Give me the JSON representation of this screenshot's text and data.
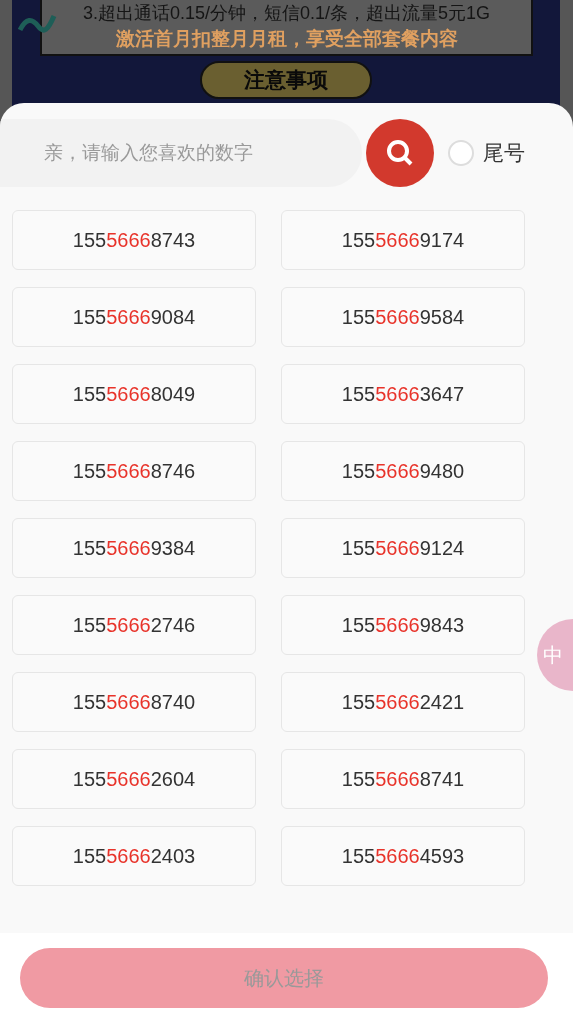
{
  "background": {
    "notes": [
      "3.超出通话0.15/分钟，短信0.1/条，超出流量5元1G",
      "激活首月扣整月月租，享受全部套餐内容"
    ],
    "section_title": "注意事项"
  },
  "search": {
    "placeholder": "亲，请输入您喜欢的数字"
  },
  "tail_option": {
    "label": "尾号",
    "checked": false
  },
  "numbers": [
    {
      "prefix": "155",
      "middle": "5666",
      "suffix": "8743",
      "selected": false
    },
    {
      "prefix": "155",
      "middle": "5666",
      "suffix": "9174",
      "selected": false
    },
    {
      "prefix": "155",
      "middle": "5666",
      "suffix": "9084",
      "selected": false
    },
    {
      "prefix": "155",
      "middle": "5666",
      "suffix": "9584",
      "selected": false
    },
    {
      "prefix": "155",
      "middle": "5666",
      "suffix": "8049",
      "selected": false
    },
    {
      "prefix": "155",
      "middle": "5666",
      "suffix": "3647",
      "selected": false
    },
    {
      "prefix": "155",
      "middle": "5666",
      "suffix": "8746",
      "selected": false
    },
    {
      "prefix": "155",
      "middle": "5666",
      "suffix": "9480",
      "selected": false
    },
    {
      "prefix": "155",
      "middle": "5666",
      "suffix": "9384",
      "selected": false
    },
    {
      "prefix": "155",
      "middle": "5666",
      "suffix": "9124",
      "selected": false
    },
    {
      "prefix": "155",
      "middle": "5666",
      "suffix": "2746",
      "selected": false
    },
    {
      "prefix": "155",
      "middle": "5666",
      "suffix": "9843",
      "selected": false
    },
    {
      "prefix": "155",
      "middle": "5666",
      "suffix": "8740",
      "selected": false
    },
    {
      "prefix": "155",
      "middle": "5666",
      "suffix": "2421",
      "selected": false
    },
    {
      "prefix": "155",
      "middle": "5666",
      "suffix": "2604",
      "selected": false
    },
    {
      "prefix": "155",
      "middle": "5666",
      "suffix": "8741",
      "selected": false
    },
    {
      "prefix": "155",
      "middle": "5666",
      "suffix": "2403",
      "selected": false
    },
    {
      "prefix": "155",
      "middle": "5666",
      "suffix": "4593",
      "selected": false
    }
  ],
  "float_button": {
    "label": "中"
  },
  "confirm_button": {
    "label": "确认选择",
    "disabled": true
  }
}
